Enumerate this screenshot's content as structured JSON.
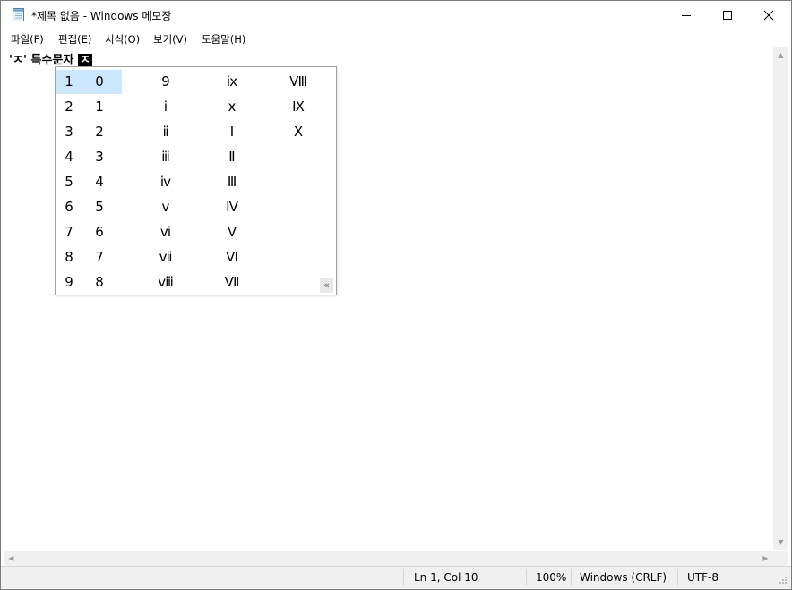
{
  "window": {
    "title": "*제목 없음 - Windows 메모장"
  },
  "menu": [
    "파일(F)",
    "편집(E)",
    "서식(O)",
    "보기(V)",
    "도움말(H)"
  ],
  "editor": {
    "text": "'ㅈ' 특수문자 ",
    "composing": "ㅈ"
  },
  "candidates": {
    "numbers": [
      "1",
      "2",
      "3",
      "4",
      "5",
      "6",
      "7",
      "8",
      "9"
    ],
    "rows": [
      [
        "0",
        "9",
        "ⅸ",
        "Ⅷ"
      ],
      [
        "1",
        "ⅰ",
        "ⅹ",
        "Ⅸ"
      ],
      [
        "2",
        "ⅱ",
        "Ⅰ",
        "Ⅹ"
      ],
      [
        "3",
        "ⅲ",
        "Ⅱ",
        ""
      ],
      [
        "4",
        "ⅳ",
        "Ⅲ",
        ""
      ],
      [
        "5",
        "ⅴ",
        "Ⅳ",
        ""
      ],
      [
        "6",
        "ⅵ",
        "Ⅴ",
        ""
      ],
      [
        "7",
        "ⅶ",
        "Ⅵ",
        ""
      ],
      [
        "8",
        "ⅷ",
        "Ⅶ",
        ""
      ]
    ],
    "selected_index": 0,
    "collapse_label": "«"
  },
  "status": {
    "position": "Ln 1, Col 10",
    "zoom": "100%",
    "line_ending": "Windows (CRLF)",
    "encoding": "UTF-8"
  },
  "icons": {
    "app": "notepad-icon",
    "minimize": "minimize-icon",
    "maximize": "maximize-icon",
    "close": "close-icon",
    "scroll_up": "scroll-up-arrow",
    "scroll_down": "scroll-down-arrow",
    "scroll_left": "scroll-left-arrow",
    "scroll_right": "scroll-right-arrow"
  },
  "colors": {
    "selection": "#cce8ff",
    "composition_bg": "#000000"
  }
}
